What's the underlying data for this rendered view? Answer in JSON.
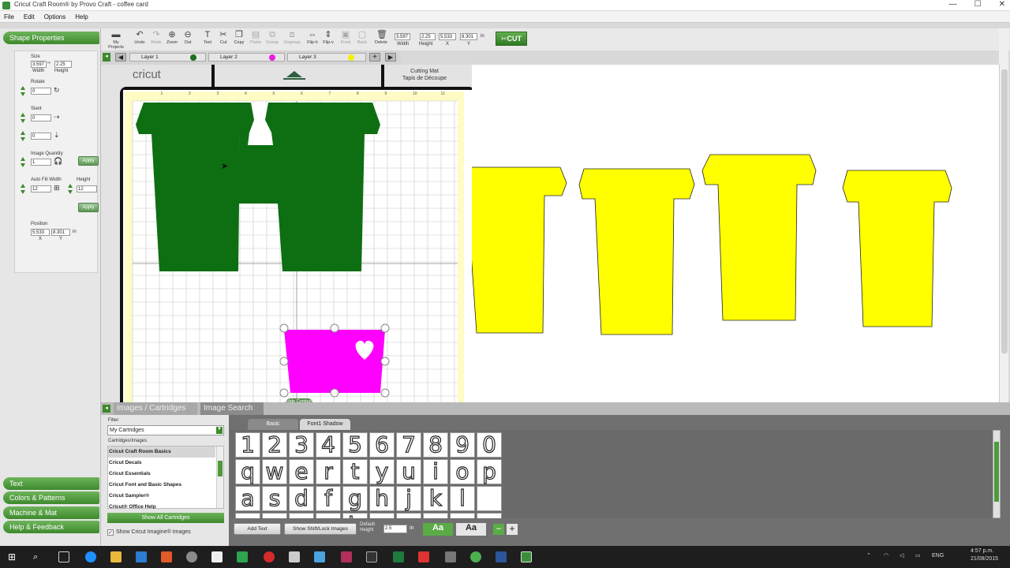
{
  "window": {
    "title": "Cricut Craft Room® by Provo Craft - coffee card",
    "controls": [
      "—",
      "☐",
      "✕"
    ]
  },
  "menu": [
    "File",
    "Edit",
    "Options",
    "Help"
  ],
  "left_panel": {
    "shape_properties_title": "Shape Properties",
    "size_label": "Size",
    "width_value": "3.597",
    "height_value": "2.25",
    "width_label": "Width",
    "height_label": "Height",
    "rotate_label": "Rotate",
    "rotate_value": "0",
    "slant_label": "Slant",
    "slant_value_1": "0",
    "slant_value_2": "0",
    "image_quantity_label": "Image Quantity",
    "image_quantity_value": "1",
    "apply_label": "Apply",
    "autofill_width_label": "Auto Fill Width",
    "autofill_width_value": "12",
    "autofill_height_label": "Height",
    "autofill_height_value": "12",
    "apply_label_2": "Apply",
    "position_label": "Position",
    "pos_x_value": "5.533",
    "pos_y_value": "8.301",
    "pos_unit": "in",
    "x_label": "X",
    "y_label": "Y",
    "bottom_tabs": [
      "Text",
      "Colors & Patterns",
      "Machine & Mat",
      "Help & Feedback"
    ]
  },
  "toolbar": {
    "tools": [
      {
        "label": "My Projects",
        "icon": "folder-icon",
        "enabled": true
      },
      {
        "label": "Undo",
        "icon": "undo-icon",
        "enabled": true
      },
      {
        "label": "Redo",
        "icon": "redo-icon",
        "enabled": false
      },
      {
        "label": "Zoom",
        "icon": "zoom-in-icon",
        "enabled": true
      },
      {
        "label": "Out",
        "icon": "zoom-out-icon",
        "enabled": true
      },
      {
        "label": "Text",
        "icon": "text-icon",
        "enabled": true
      },
      {
        "label": "Cut",
        "icon": "scissors-icon",
        "enabled": true
      },
      {
        "label": "Copy",
        "icon": "copy-icon",
        "enabled": true
      },
      {
        "label": "Paste",
        "icon": "paste-icon",
        "enabled": false
      },
      {
        "label": "Group",
        "icon": "group-icon",
        "enabled": false
      },
      {
        "label": "Ungroup",
        "icon": "ungroup-icon",
        "enabled": false
      },
      {
        "label": "Flip-h",
        "icon": "flip-horizontal-icon",
        "enabled": true
      },
      {
        "label": "Flip-v",
        "icon": "flip-vertical-icon",
        "enabled": true
      },
      {
        "label": "Front",
        "icon": "bring-front-icon",
        "enabled": false
      },
      {
        "label": "Back",
        "icon": "send-back-icon",
        "enabled": false
      },
      {
        "label": "Delete",
        "icon": "trash-icon",
        "enabled": true
      }
    ],
    "size_width": "3.597",
    "size_height": "2.25",
    "pos_x": "5.533",
    "pos_y": "8.301",
    "unit": "in",
    "width_label": "Width",
    "height_label": "Height",
    "x_label": "X",
    "y_label": "Y",
    "cut_label": "✂CUT"
  },
  "layers": [
    {
      "name": "Layer 1",
      "color": "#1e6e1e"
    },
    {
      "name": "Layer 2",
      "color": "#e81ee0"
    },
    {
      "name": "Layer 3",
      "color": "#f5f000"
    }
  ],
  "mat": {
    "brand": "cricut",
    "title_en": "Cutting Mat",
    "title_fr": "Tapis de Découpe",
    "ruler_numbers": [
      "1",
      "2",
      "3",
      "4",
      "5",
      "6",
      "7",
      "8",
      "9",
      "10",
      "11"
    ],
    "hide_contour_label": "Hide Contour"
  },
  "colors": {
    "green": "#0e6e12",
    "magenta": "#ff00ff",
    "yellow": "#ffff00",
    "accent": "#3d8a2c"
  },
  "library": {
    "tabs": [
      "Images / Cartridges",
      "Image Search"
    ],
    "filter_label": "Filter",
    "filter_value": "My Cartridges",
    "list_label": "Cartridges/Images",
    "cartridges": [
      "Cricut Craft Room Basics",
      "Cricut Decals",
      "Cricut Essentials",
      "Cricut Font and Basic Shapes",
      "Cricut Sampler®",
      "Cricut® Office Help"
    ],
    "show_all_label": "Show All Cartridges",
    "imagine_label": "Show Cricut Imagine® Images",
    "font_tabs": [
      "Basic",
      "Font1 Shadow"
    ],
    "glyph_rows": [
      [
        "1",
        "2",
        "3",
        "4",
        "5",
        "6",
        "7",
        "8",
        "9",
        "0"
      ],
      [
        "q",
        "w",
        "e",
        "r",
        "t",
        "y",
        "u",
        "i",
        "o",
        "p"
      ],
      [
        "a",
        "s",
        "d",
        "f",
        "g",
        "h",
        "j",
        "k",
        "l",
        ""
      ],
      [
        "z",
        "x",
        "c",
        "v",
        "b",
        "n",
        "m",
        "",
        "",
        ""
      ]
    ],
    "add_text_label": "Add Text",
    "shift_lock_label": "Show Shift/Lock Images",
    "default_height_label": "Default Height",
    "default_height_value": "2.5",
    "default_height_unit": "in",
    "aa1": "Aa",
    "aa2": "Aa"
  },
  "taskbar": {
    "lang": "ENG",
    "time": "4:57 p.m.",
    "date": "21/08/2015"
  }
}
